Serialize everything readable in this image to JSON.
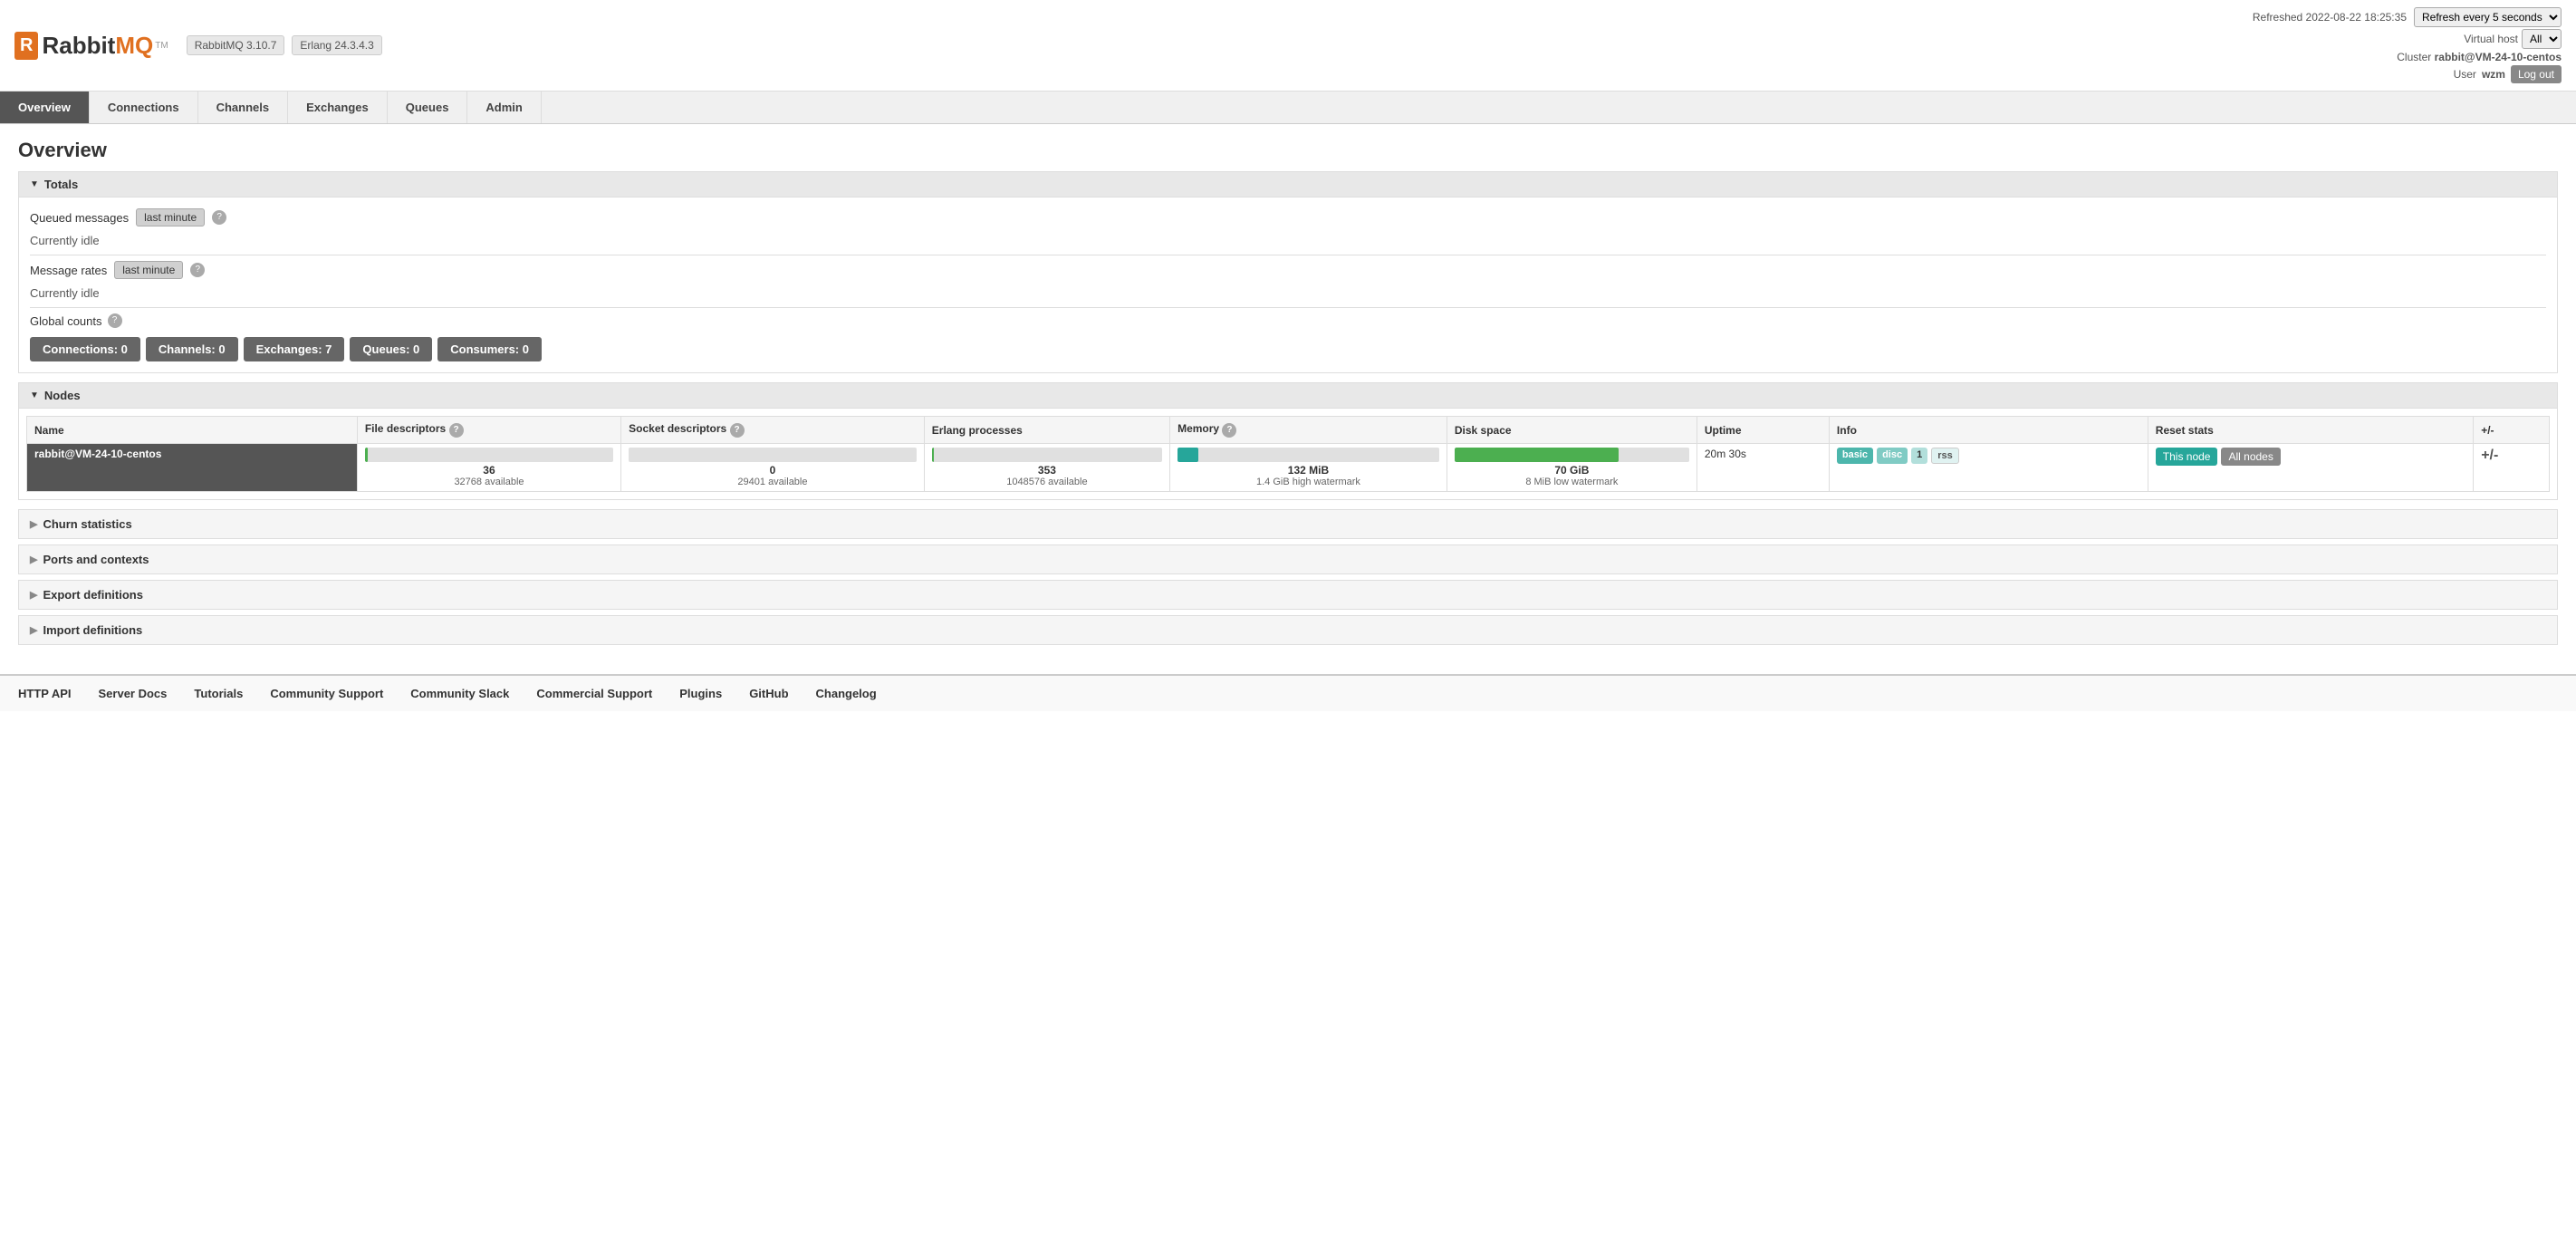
{
  "header": {
    "logo_text_rabbit": "Rabbit",
    "logo_text_mq": "MQ",
    "logo_tm": "TM",
    "version_rabbitmq": "RabbitMQ 3.10.7",
    "version_erlang": "Erlang 24.3.4.3",
    "refreshed_label": "Refreshed 2022-08-22 18:25:35",
    "refresh_select_value": "Refresh every 5 seconds",
    "virtual_host_label": "Virtual host",
    "virtual_host_value": "All",
    "cluster_label": "Cluster",
    "cluster_value": "rabbit@VM-24-10-centos",
    "user_label": "User",
    "user_value": "wzm",
    "logout_label": "Log out"
  },
  "nav": {
    "items": [
      {
        "id": "overview",
        "label": "Overview",
        "active": true
      },
      {
        "id": "connections",
        "label": "Connections",
        "active": false
      },
      {
        "id": "channels",
        "label": "Channels",
        "active": false
      },
      {
        "id": "exchanges",
        "label": "Exchanges",
        "active": false
      },
      {
        "id": "queues",
        "label": "Queues",
        "active": false
      },
      {
        "id": "admin",
        "label": "Admin",
        "active": false
      }
    ]
  },
  "page_title": "Overview",
  "totals": {
    "section_label": "Totals",
    "queued_messages_label": "Queued messages",
    "queued_messages_badge": "last minute",
    "queued_messages_help": "?",
    "queued_idle": "Currently idle",
    "message_rates_label": "Message rates",
    "message_rates_badge": "last minute",
    "message_rates_help": "?",
    "message_rates_idle": "Currently idle",
    "global_counts_label": "Global counts",
    "global_counts_help": "?",
    "counts": [
      {
        "label": "Connections:",
        "value": "0",
        "full": "Connections: 0"
      },
      {
        "label": "Channels:",
        "value": "0",
        "full": "Channels: 0"
      },
      {
        "label": "Exchanges:",
        "value": "7",
        "full": "Exchanges: 7"
      },
      {
        "label": "Queues:",
        "value": "0",
        "full": "Queues: 0"
      },
      {
        "label": "Consumers:",
        "value": "0",
        "full": "Consumers: 0"
      }
    ]
  },
  "nodes": {
    "section_label": "Nodes",
    "columns": [
      "Name",
      "File descriptors",
      "Socket descriptors",
      "Erlang processes",
      "Memory",
      "Disk space",
      "Uptime",
      "Info",
      "Reset stats",
      "+/-"
    ],
    "file_desc_help": "?",
    "socket_desc_help": "?",
    "memory_help": "?",
    "rows": [
      {
        "name": "rabbit@VM-24-10-centos",
        "file_desc_value": "36",
        "file_desc_available": "32768 available",
        "file_desc_pct": 0.5,
        "socket_desc_value": "0",
        "socket_desc_available": "29401 available",
        "socket_desc_pct": 0,
        "erlang_proc_value": "353",
        "erlang_proc_available": "1048576 available",
        "erlang_proc_pct": 0.5,
        "memory_value": "132 MiB",
        "memory_watermark": "1.4 GiB high watermark",
        "memory_pct": 8,
        "disk_space_value": "70 GiB",
        "disk_space_watermark": "8 MiB low watermark",
        "disk_space_pct": 70,
        "uptime": "20m 30s",
        "info_badges": [
          "basic",
          "disc",
          "1",
          "rss"
        ],
        "reset_this_node": "This node",
        "reset_all_nodes": "All nodes"
      }
    ]
  },
  "collapse_sections": [
    {
      "id": "churn",
      "label": "Churn statistics"
    },
    {
      "id": "ports",
      "label": "Ports and contexts"
    },
    {
      "id": "export",
      "label": "Export definitions"
    },
    {
      "id": "import",
      "label": "Import definitions"
    }
  ],
  "footer": {
    "links": [
      {
        "id": "http-api",
        "label": "HTTP API"
      },
      {
        "id": "server-docs",
        "label": "Server Docs"
      },
      {
        "id": "tutorials",
        "label": "Tutorials"
      },
      {
        "id": "community-support",
        "label": "Community Support"
      },
      {
        "id": "community-slack",
        "label": "Community Slack"
      },
      {
        "id": "commercial-support",
        "label": "Commercial Support"
      },
      {
        "id": "plugins",
        "label": "Plugins"
      },
      {
        "id": "github",
        "label": "GitHub"
      },
      {
        "id": "changelog",
        "label": "Changelog"
      }
    ]
  }
}
